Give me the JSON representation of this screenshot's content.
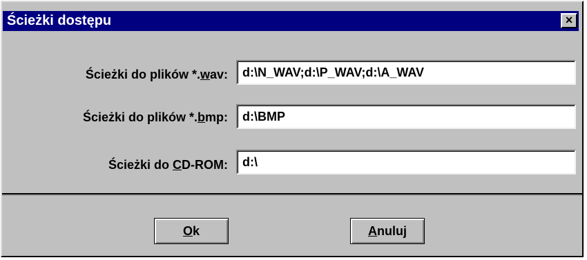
{
  "window": {
    "title": "Ścieżki dostępu",
    "close_symbol": "×"
  },
  "fields": [
    {
      "label_pre": "Ścieżki do plików *.",
      "label_acc": "w",
      "label_post": "av:",
      "value": "d:\\N_WAV;d:\\P_WAV;d:\\A_WAV"
    },
    {
      "label_pre": "Ścieżki do plików *.",
      "label_acc": "b",
      "label_post": "mp:",
      "value": "d:\\BMP"
    },
    {
      "label_pre": "Ścieżki do ",
      "label_acc": "C",
      "label_post": "D-ROM:",
      "value": "d:\\"
    }
  ],
  "buttons": {
    "ok": {
      "acc": "O",
      "rest": "k"
    },
    "cancel": {
      "acc": "A",
      "rest": "nuluj"
    }
  }
}
